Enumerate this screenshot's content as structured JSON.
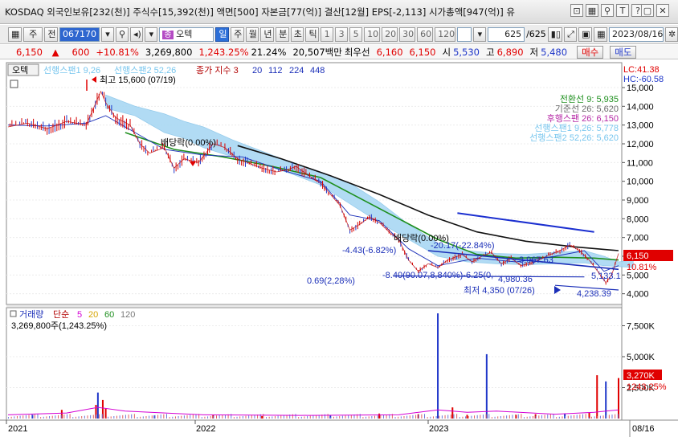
{
  "window": {
    "title": "KOSDAQ 외국인보유[232(천)] 주식수[15,392(천)] 액면[500] 자본금[77(억)] 결산[12월] EPS[-2,113] 시가총액[947(억)] 유",
    "icons": [
      "window-icon",
      "chart-icon",
      "pin-icon",
      "text-icon",
      "help-icon",
      "restore-icon",
      "close-icon"
    ],
    "icon_glyphs": [
      "⊡",
      "▦",
      "⚲",
      "T",
      "?",
      "▢",
      "✕"
    ]
  },
  "toolbar": {
    "main_label": "주",
    "prev_label": "전",
    "code": "067170",
    "stock_badge": "종",
    "stock_name": "오텍",
    "periods": [
      "일",
      "주",
      "월",
      "년",
      "분",
      "초",
      "틱"
    ],
    "active_period": "일",
    "intervals": [
      "1",
      "3",
      "5",
      "10",
      "20",
      "30",
      "60",
      "120"
    ],
    "count_value": "625",
    "count_total": "/625",
    "date": "2023/08/16"
  },
  "infobar": {
    "price": "6,150",
    "arrow": "▲",
    "change": "600",
    "change_pct": "+10.81%",
    "volume": "3,269,800",
    "volume_pct": "1,243.25%",
    "turnover": "21.24%",
    "amount": "20,507백만",
    "priority_label": "최우선",
    "ask": "6,160",
    "bid": "6,150",
    "open_label": "시",
    "open": "5,530",
    "high_label": "고",
    "high": "6,890",
    "low_label": "저",
    "low": "5,480",
    "buy_label": "매수",
    "sell_label": "매도"
  },
  "legend": {
    "stock_name": "오텍",
    "span1": "선행스팬1 9,26",
    "span2": "선행스팬2 52,26",
    "ma_title": "종가 지수 3",
    "ma_periods": [
      "20",
      "112",
      "224",
      "448"
    ],
    "ma_colors": [
      "#1b2fb8",
      "#1b2fb8",
      "#1b2fb8",
      "#1b2fb8"
    ],
    "lc": "LC:41.38",
    "hc": "HC:-60.58"
  },
  "ichimoku_values": {
    "conversion": "전환선 9: 5,935",
    "base": "기준선 26: 5,620",
    "lagging": "후행스팬 26: 6,150",
    "span1": "선행스팬1 9,26: 5,778",
    "span2": "선행스팬2 52,26: 5,620"
  },
  "annotations": {
    "high": "최고 15,600 (07/19)",
    "low": "최저 4,350 (07/26)",
    "dividend1": "배당락(0.00%)",
    "dividend2": "배당락(0.00%)",
    "trend1": "-4.43(-6.82%)",
    "trend2": "-20.17(-22.84%)",
    "trend3": "3,967.63",
    "trend4": "-8.40(90.07,8,840%)-6.25(0,",
    "trend5": "4,980.36",
    "trend6": "0.69(2,28%)",
    "right1": "5,133.1",
    "right2": "4,238.39"
  },
  "price_axis": {
    "current_price": "6,150",
    "current_pct": "10.81%"
  },
  "volume_panel": {
    "title": "거래량",
    "mode": "단순",
    "ma_periods": [
      "5",
      "20",
      "60",
      "120"
    ],
    "ma_colors": [
      "#d400d4",
      "#d6a400",
      "#1f8f1f",
      "#7a7a7a"
    ],
    "value": "3,269,800주(1,243.25%)",
    "axis_labels": [
      "7,500K",
      "5,000K",
      "2,500K"
    ],
    "current": "3,270K",
    "current_pct": "1243.25%"
  },
  "date_axis": {
    "labels": [
      "2021",
      "2022",
      "2023"
    ],
    "end_label": "08/16"
  },
  "chart_data": {
    "type": "line",
    "price_ticks": [
      4000,
      5000,
      6000,
      7000,
      8000,
      9000,
      10000,
      11000,
      12000,
      13000,
      14000,
      15000
    ],
    "price_tick_labels": [
      "4,000",
      "5,000",
      "6,000",
      "7,000",
      "8,000",
      "9,000",
      "10,000",
      "11,000",
      "12,000",
      "13,000",
      "14,000",
      "15,000"
    ],
    "ylim": [
      3600,
      16200
    ],
    "x_range": [
      0,
      625
    ],
    "close": [
      [
        0,
        12900
      ],
      [
        20,
        13100
      ],
      [
        40,
        12800
      ],
      [
        60,
        13200
      ],
      [
        80,
        13000
      ],
      [
        95,
        14800
      ],
      [
        100,
        14200
      ],
      [
        110,
        13400
      ],
      [
        125,
        13000
      ],
      [
        135,
        12000
      ],
      [
        145,
        11500
      ],
      [
        160,
        11800
      ],
      [
        170,
        10700
      ],
      [
        180,
        11200
      ],
      [
        195,
        11000
      ],
      [
        210,
        12000
      ],
      [
        222,
        11800
      ],
      [
        235,
        11200
      ],
      [
        245,
        11000
      ],
      [
        260,
        10700
      ],
      [
        275,
        10500
      ],
      [
        285,
        10600
      ],
      [
        295,
        10800
      ],
      [
        305,
        10400
      ],
      [
        320,
        9900
      ],
      [
        330,
        9300
      ],
      [
        340,
        8700
      ],
      [
        350,
        7400
      ],
      [
        360,
        7700
      ],
      [
        370,
        8100
      ],
      [
        380,
        7800
      ],
      [
        390,
        7300
      ],
      [
        400,
        6900
      ],
      [
        410,
        5800
      ],
      [
        420,
        5200
      ],
      [
        430,
        5600
      ],
      [
        440,
        5400
      ],
      [
        450,
        5800
      ],
      [
        465,
        6100
      ],
      [
        475,
        5700
      ],
      [
        485,
        6000
      ],
      [
        495,
        6200
      ],
      [
        505,
        5600
      ],
      [
        515,
        5900
      ],
      [
        525,
        5500
      ],
      [
        540,
        5700
      ],
      [
        555,
        6100
      ],
      [
        565,
        6300
      ],
      [
        575,
        6600
      ],
      [
        585,
        6300
      ],
      [
        595,
        5800
      ],
      [
        605,
        5100
      ],
      [
        612,
        4600
      ],
      [
        618,
        5000
      ],
      [
        625,
        6150
      ]
    ],
    "ma_fast": [
      [
        0,
        13000
      ],
      [
        40,
        12950
      ],
      [
        80,
        13100
      ],
      [
        100,
        13500
      ],
      [
        130,
        12600
      ],
      [
        160,
        11700
      ],
      [
        200,
        11400
      ],
      [
        240,
        11300
      ],
      [
        280,
        10600
      ],
      [
        320,
        10000
      ],
      [
        350,
        8200
      ],
      [
        380,
        7900
      ],
      [
        410,
        6400
      ],
      [
        440,
        5500
      ],
      [
        480,
        5900
      ],
      [
        520,
        5700
      ],
      [
        560,
        6000
      ],
      [
        590,
        6300
      ],
      [
        610,
        5200
      ],
      [
        625,
        5500
      ]
    ],
    "ma_112": [
      [
        120,
        12600
      ],
      [
        170,
        11700
      ],
      [
        220,
        11300
      ],
      [
        270,
        10800
      ],
      [
        320,
        10200
      ],
      [
        360,
        9100
      ],
      [
        400,
        8000
      ],
      [
        440,
        6900
      ],
      [
        480,
        6100
      ],
      [
        520,
        5900
      ],
      [
        560,
        5950
      ],
      [
        600,
        5900
      ],
      [
        625,
        5800
      ]
    ],
    "ma_224": [
      [
        235,
        11900
      ],
      [
        280,
        11200
      ],
      [
        330,
        10300
      ],
      [
        380,
        9300
      ],
      [
        430,
        8200
      ],
      [
        480,
        7300
      ],
      [
        530,
        6800
      ],
      [
        580,
        6500
      ],
      [
        625,
        6300
      ]
    ],
    "cloud_upper": [
      [
        100,
        14600
      ],
      [
        130,
        14000
      ],
      [
        160,
        13600
      ],
      [
        180,
        13200
      ],
      [
        200,
        12900
      ],
      [
        230,
        12200
      ],
      [
        260,
        11600
      ],
      [
        290,
        11000
      ],
      [
        320,
        10500
      ],
      [
        350,
        9900
      ],
      [
        380,
        8900
      ],
      [
        410,
        7700
      ],
      [
        440,
        6700
      ],
      [
        470,
        6300
      ],
      [
        500,
        6150
      ],
      [
        530,
        6100
      ],
      [
        560,
        6200
      ],
      [
        590,
        6300
      ],
      [
        610,
        6000
      ],
      [
        625,
        5700
      ],
      [
        640,
        5800
      ]
    ],
    "cloud_lower": [
      [
        100,
        13900
      ],
      [
        130,
        13500
      ],
      [
        160,
        12600
      ],
      [
        180,
        12300
      ],
      [
        200,
        11800
      ],
      [
        230,
        11300
      ],
      [
        260,
        10900
      ],
      [
        290,
        10400
      ],
      [
        320,
        9800
      ],
      [
        350,
        8800
      ],
      [
        380,
        7800
      ],
      [
        410,
        6900
      ],
      [
        440,
        6000
      ],
      [
        470,
        5700
      ],
      [
        500,
        5600
      ],
      [
        530,
        5550
      ],
      [
        560,
        5600
      ],
      [
        590,
        5650
      ],
      [
        610,
        5500
      ],
      [
        625,
        5450
      ],
      [
        640,
        5400
      ]
    ],
    "trendline_blue": [
      [
        460,
        8300
      ],
      [
        600,
        7300
      ]
    ],
    "trendline_navy": [
      [
        430,
        6300
      ],
      [
        625,
        5300
      ]
    ],
    "trendline_support": [
      [
        395,
        4950
      ],
      [
        590,
        4900
      ]
    ],
    "trendline_low": [
      [
        560,
        4450
      ],
      [
        625,
        4200
      ]
    ],
    "volume_ticks": [
      2500,
      5000,
      7500
    ],
    "volume_ylim": [
      0,
      8700
    ],
    "volume": [
      [
        25,
        300
      ],
      [
        55,
        700
      ],
      [
        90,
        1100
      ],
      [
        92,
        2100
      ],
      [
        97,
        1500
      ],
      [
        100,
        800
      ],
      [
        150,
        250
      ],
      [
        210,
        300
      ],
      [
        260,
        200
      ],
      [
        330,
        250
      ],
      [
        380,
        400
      ],
      [
        420,
        350
      ],
      [
        440,
        8500
      ],
      [
        455,
        900
      ],
      [
        470,
        300
      ],
      [
        490,
        5200
      ],
      [
        520,
        300
      ],
      [
        540,
        350
      ],
      [
        570,
        400
      ],
      [
        595,
        500
      ],
      [
        603,
        3500
      ],
      [
        612,
        3000
      ],
      [
        625,
        3270
      ]
    ],
    "volume_ma": [
      [
        0,
        300
      ],
      [
        60,
        450
      ],
      [
        92,
        900
      ],
      [
        120,
        600
      ],
      [
        200,
        300
      ],
      [
        300,
        250
      ],
      [
        400,
        300
      ],
      [
        440,
        700
      ],
      [
        470,
        500
      ],
      [
        500,
        600
      ],
      [
        560,
        350
      ],
      [
        600,
        500
      ],
      [
        625,
        700
      ]
    ]
  }
}
